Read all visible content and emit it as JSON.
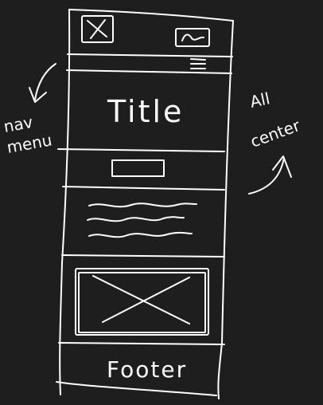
{
  "wireframe": {
    "title": "Title",
    "footer": "Footer",
    "notes": {
      "left": [
        "nav",
        "menu"
      ],
      "right": [
        "All",
        "center"
      ]
    },
    "icons": {
      "logo": "image-placeholder-icon",
      "header_image": "image-icon",
      "menu": "hamburger-menu-icon",
      "hero_image": "image-placeholder-icon"
    },
    "colors": {
      "background": "#1e1e1e",
      "ink": "#ffffff"
    }
  }
}
